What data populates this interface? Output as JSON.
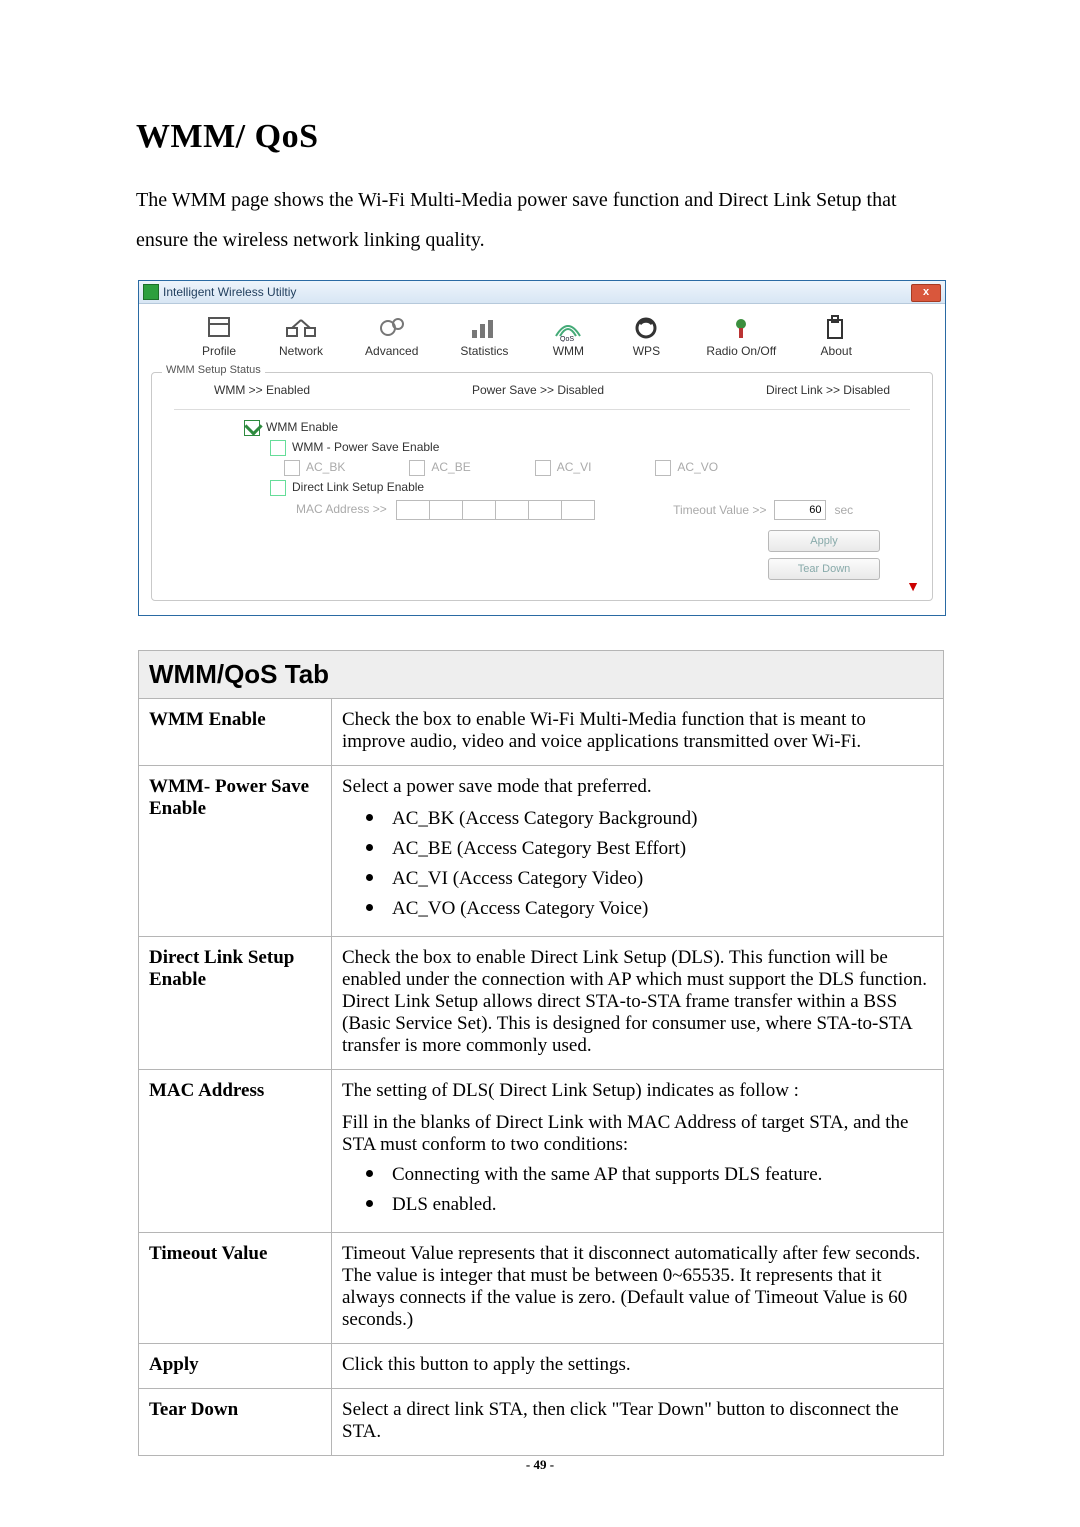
{
  "heading": "WMM/ QoS",
  "intro": "The WMM page shows the Wi-Fi Multi-Media power save function and Direct Link Setup that ensure the wireless network linking quality.",
  "screenshot": {
    "window_title": "Intelligent Wireless Utiltiy",
    "toolbar": {
      "profile": "Profile",
      "network": "Network",
      "advanced": "Advanced",
      "statistics": "Statistics",
      "wmm": "WMM",
      "wps": "WPS",
      "radio": "Radio On/Off",
      "about": "About"
    },
    "section_legend": "WMM Setup Status",
    "status": {
      "wmm": "WMM >>  Enabled",
      "ps": "Power Save >>  Disabled",
      "dl": "Direct Link >>  Disabled"
    },
    "opts": {
      "wmm_enable": "WMM Enable",
      "ps_enable": "WMM - Power Save Enable",
      "ac_bk": "AC_BK",
      "ac_be": "AC_BE",
      "ac_vi": "AC_VI",
      "ac_vo": "AC_VO",
      "dls_enable": "Direct Link Setup Enable",
      "mac_label": "MAC Address >>",
      "timeout_label": "Timeout Value >>",
      "timeout_value": "60",
      "timeout_unit": "sec"
    },
    "buttons": {
      "apply": "Apply",
      "tear_down": "Tear Down"
    }
  },
  "table": {
    "header": "WMM/QoS Tab",
    "rows": {
      "wmm_enable": {
        "label": "WMM Enable",
        "text": "Check the box to enable Wi-Fi Multi-Media function that is meant to improve audio, video and voice applications transmitted over Wi-Fi."
      },
      "ps_enable": {
        "label": "WMM- Power Save Enable",
        "lead": "Select a power save mode that preferred.",
        "items": {
          "a": "AC_BK (Access Category Background)",
          "b": "AC_BE (Access Category Best Effort)",
          "c": "AC_VI (Access Category Video)",
          "d": "AC_VO (Access Category Voice)"
        }
      },
      "dls_enable": {
        "label": "Direct Link Setup Enable",
        "text": "Check the box to enable Direct Link Setup (DLS). This function will be enabled under the connection with AP which must support the DLS function. Direct Link Setup allows direct STA-to-STA frame transfer within a BSS (Basic Service Set). This is designed for consumer use, where STA-to-STA transfer is more commonly used."
      },
      "mac": {
        "label": "MAC Address",
        "lead": "The setting of DLS( Direct Link Setup) indicates as follow :",
        "para": "Fill in the blanks of Direct Link with MAC Address of target STA, and the STA must conform to two conditions:",
        "items": {
          "a": "Connecting with the same AP that supports DLS feature.",
          "b": "DLS enabled."
        }
      },
      "timeout": {
        "label": "Timeout Value",
        "text": "Timeout Value represents that it disconnect automatically after few seconds. The value is integer that must be between 0~65535. It represents that it always connects if the value is zero. (Default value of Timeout Value is 60 seconds.)"
      },
      "apply": {
        "label": "Apply",
        "text": "Click this button to apply the settings."
      },
      "tear": {
        "label": "Tear Down",
        "text": "Select a direct link STA, then click \"Tear Down\" button to disconnect the STA."
      }
    }
  },
  "page_number": "- 49 -"
}
